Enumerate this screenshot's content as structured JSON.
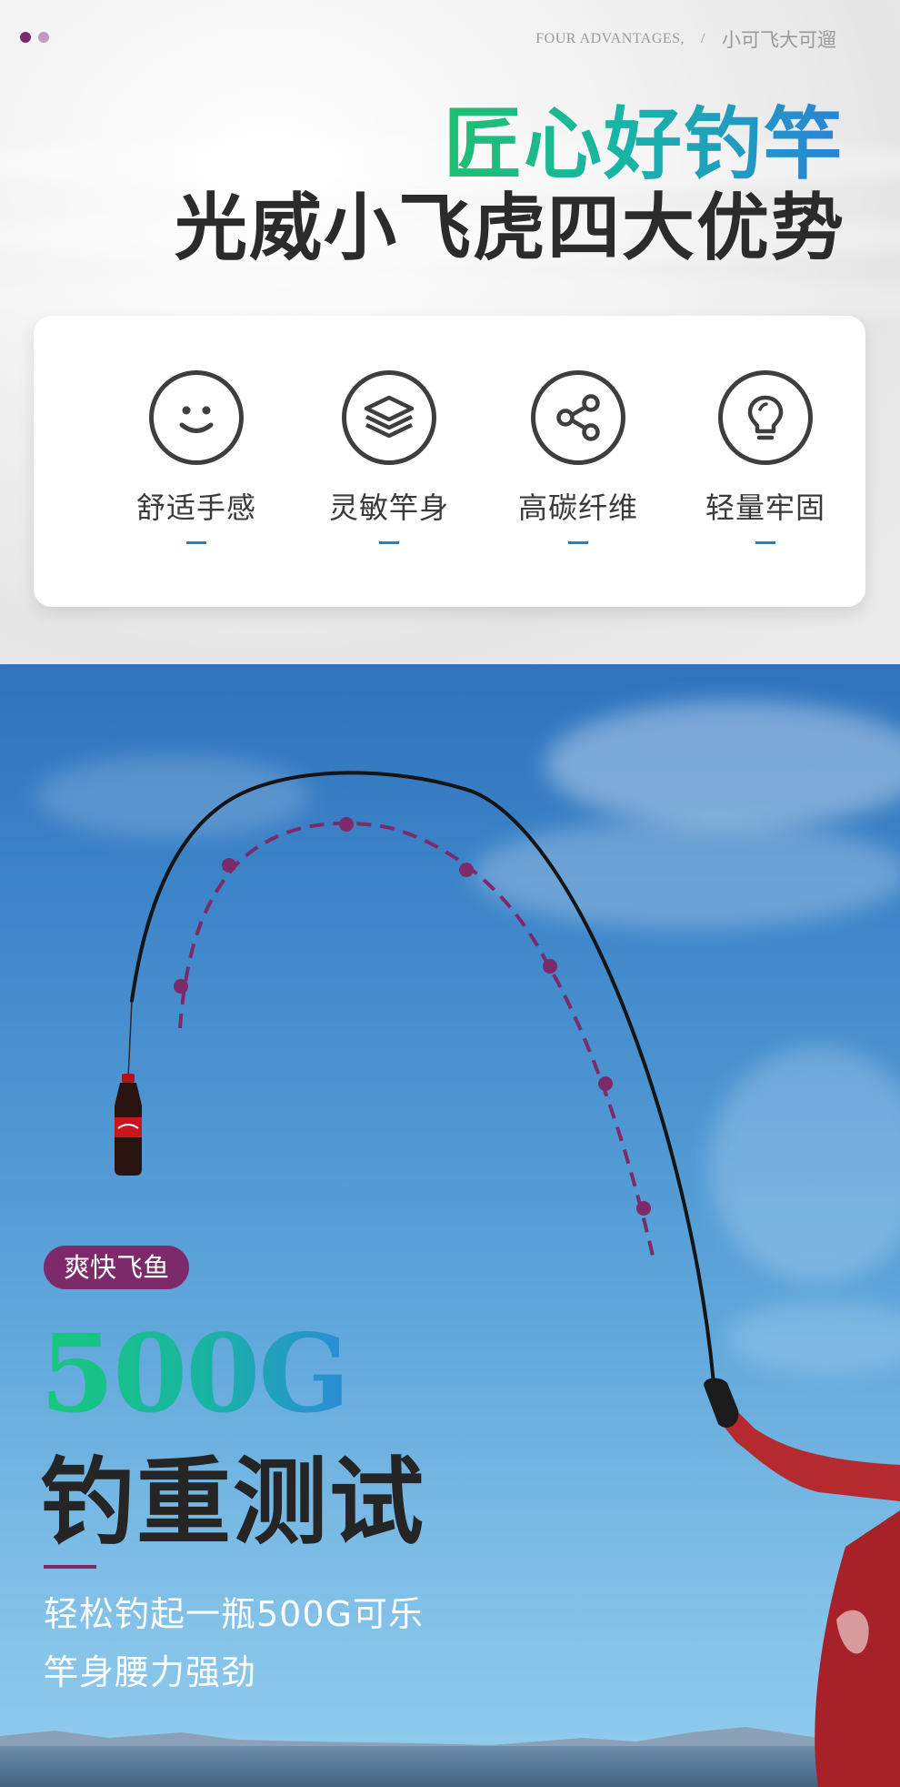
{
  "header": {
    "en_tagline": "FOUR ADVANTAGES,",
    "separator": "/",
    "cn_tagline": "小可飞大可遛",
    "title_line1": "匠心好钓竿",
    "title_line2": "光威小飞虎四大优势"
  },
  "features": [
    {
      "label": "舒适手感",
      "icon": "smiley-icon"
    },
    {
      "label": "灵敏竿身",
      "icon": "layers-icon"
    },
    {
      "label": "高碳纤维",
      "icon": "share-icon"
    },
    {
      "label": "轻量牢固",
      "icon": "lightbulb-icon"
    }
  ],
  "hero": {
    "tag": "爽快飞鱼",
    "weight": "500G",
    "title": "钓重测试",
    "desc_line1": "轻松钓起一瓶500G可乐",
    "desc_line2": "竿身腰力强劲"
  },
  "colors": {
    "accent_purple": "#7d2a6b",
    "accent_green": "#1fc06f",
    "accent_blue": "#2a83d8",
    "dash_blue": "#1e7fd1"
  }
}
